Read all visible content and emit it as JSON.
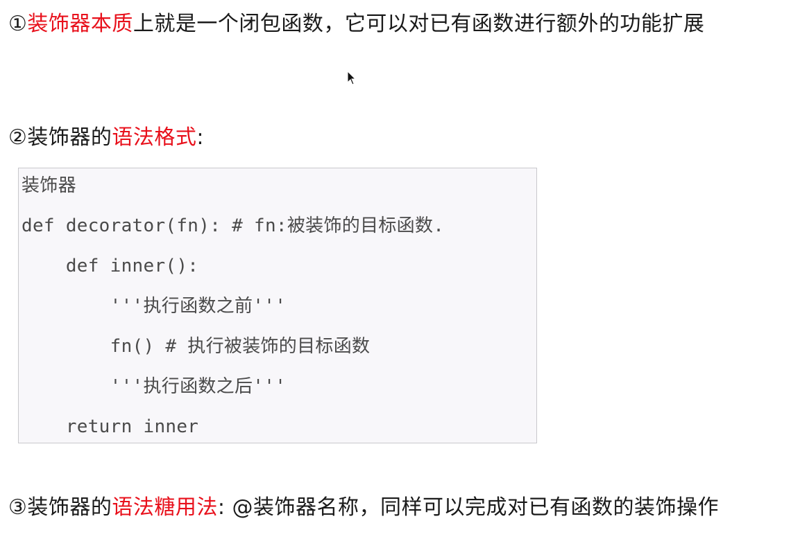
{
  "points": {
    "p1": {
      "num": "①",
      "highlight": "装饰器本质",
      "rest": "上就是一个闭包函数，它可以对已有函数进行额外的功能扩展"
    },
    "p2": {
      "num": "②",
      "pre": "装饰器的",
      "highlight": "语法格式",
      "post": ":"
    },
    "p3": {
      "num": "③",
      "pre": "装饰器的",
      "highlight": "语法糖用法",
      "post": ": @装饰器名称，同样可以完成对已有函数的装饰操作"
    }
  },
  "code": {
    "lines": [
      "装饰器",
      "def decorator(fn): # fn:被装饰的目标函数.",
      "    def inner():",
      "        '''执行函数之前'''",
      "        fn() # 执行被装饰的目标函数",
      "        '''执行函数之后'''",
      "    return inner"
    ]
  },
  "colors": {
    "highlight": "#e8101b",
    "text": "#1a1a1a",
    "code_bg": "#f8f7fa",
    "code_text": "#4a4a4a"
  }
}
